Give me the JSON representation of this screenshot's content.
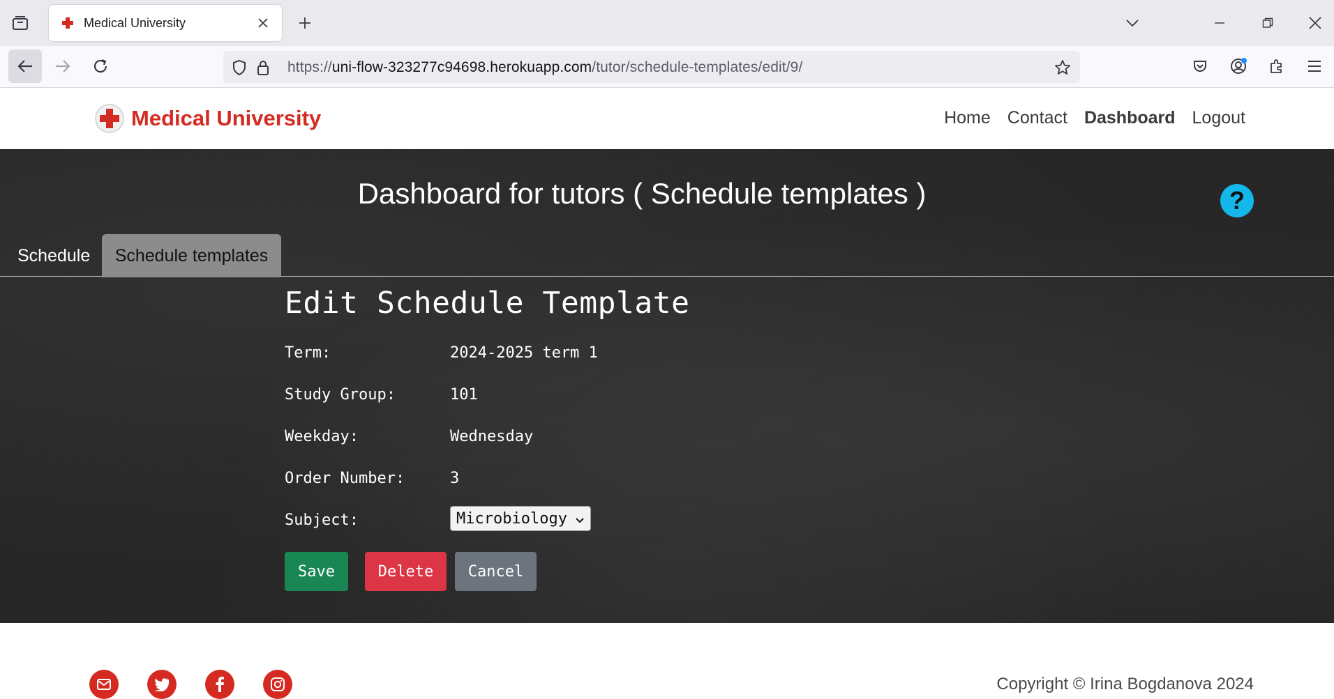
{
  "browser": {
    "tab_title": "Medical University",
    "url_prefix": "https://",
    "url_host": "uni-flow-323277c94698.herokuapp.com",
    "url_path": "/tutor/schedule-templates/edit/9/"
  },
  "site": {
    "brand": "Medical University",
    "nav": [
      "Home",
      "Contact",
      "Dashboard",
      "Logout"
    ],
    "active_nav": "Dashboard"
  },
  "dashboard": {
    "title": "Dashboard for tutors ( Schedule templates )",
    "help_glyph": "?",
    "tabs": [
      "Schedule",
      "Schedule templates"
    ],
    "active_tab": "Schedule templates"
  },
  "form": {
    "title": "Edit Schedule Template",
    "fields": [
      {
        "label": "Term:",
        "value": "2024-2025 term 1"
      },
      {
        "label": "Study Group:",
        "value": "101"
      },
      {
        "label": "Weekday:",
        "value": "Wednesday"
      },
      {
        "label": "Order Number:",
        "value": "3"
      }
    ],
    "subject": {
      "label": "Subject:",
      "selected": "Microbiology"
    },
    "buttons": {
      "save": "Save",
      "delete": "Delete",
      "cancel": "Cancel"
    }
  },
  "footer": {
    "social_icons": [
      "mail-icon",
      "twitter-icon",
      "facebook-icon",
      "instagram-icon"
    ],
    "copyright": "Copyright © Irina Bogdanova 2024"
  },
  "colors": {
    "brand_red": "#d42a22",
    "save_green": "#198754",
    "delete_red": "#dc3545",
    "cancel_gray": "#6c757d",
    "help_blue": "#14b7e9"
  }
}
